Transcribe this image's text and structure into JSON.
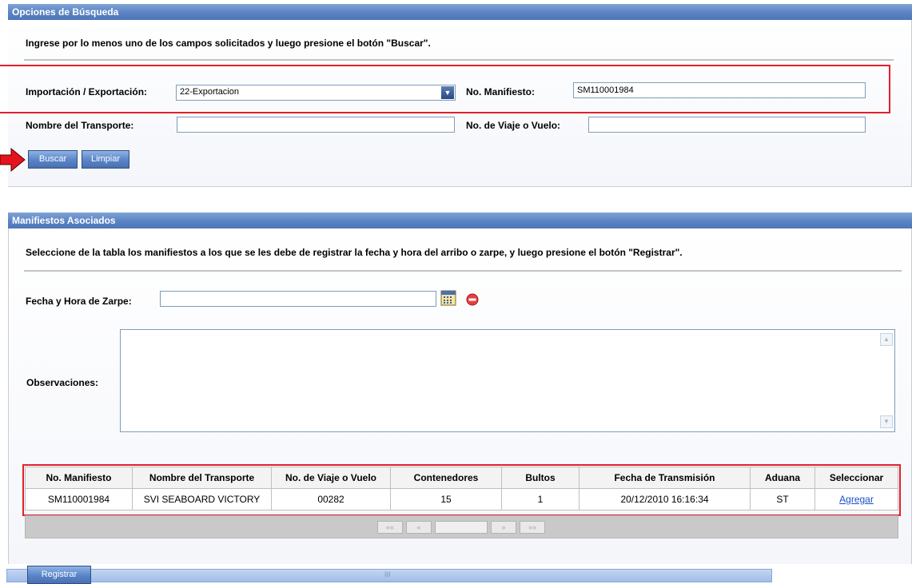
{
  "search_panel": {
    "title": "Opciones de Búsqueda",
    "instruction": "Ingrese por lo menos uno de los campos solicitados y luego presione el botón \"Buscar\".",
    "import_export_label": "Importación / Exportación:",
    "import_export_value": "22-Exportacion",
    "manifest_label": "No. Manifiesto:",
    "manifest_value": "SM110001984",
    "transport_name_label": "Nombre del Transporte:",
    "transport_name_value": "",
    "trip_label": "No. de Viaje o Vuelo:",
    "trip_value": "",
    "search_button": "Buscar",
    "clear_button": "Limpiar"
  },
  "manifests_panel": {
    "title": "Manifiestos Asociados",
    "instruction": "Seleccione de la tabla los manifiestos a los que se les debe de registrar la fecha y hora del arribo o zarpe, y luego presione el botón \"Registrar\".",
    "departure_label": "Fecha y Hora de Zarpe:",
    "departure_value": "",
    "observations_label": "Observaciones:",
    "observations_value": "",
    "table": {
      "columns": [
        "No. Manifiesto",
        "Nombre del Transporte",
        "No. de Viaje o Vuelo",
        "Contenedores",
        "Bultos",
        "Fecha de Transmisión",
        "Aduana",
        "Seleccionar"
      ],
      "rows": [
        {
          "manifest": "SM110001984",
          "transport": "SVI SEABOARD VICTORY",
          "trip": "00282",
          "containers": "15",
          "packages": "1",
          "transmission_date": "20/12/2010 16:16:34",
          "customs": "ST",
          "action": "Agregar"
        }
      ]
    },
    "pager": {
      "first": "««",
      "prev": "«",
      "next": "»",
      "last": "»»"
    }
  },
  "footer": {
    "register_button": "Registrar",
    "scroll_grip": "III"
  },
  "icons": {
    "calendar": "calendar-icon",
    "remove": "remove-icon",
    "dropdown": "chevron-down-icon",
    "pointer": "red-arrow-icon"
  },
  "colors": {
    "header_blue": "#5d85c4",
    "highlight_red": "#e3202c",
    "link_blue": "#1a4fc4"
  }
}
